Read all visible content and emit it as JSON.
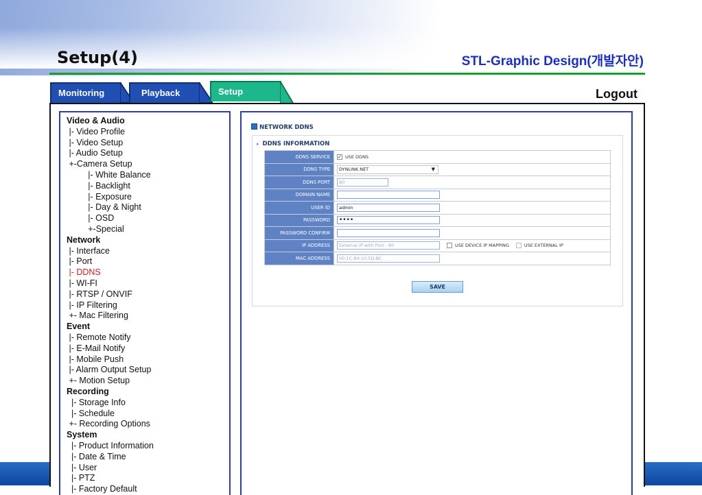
{
  "slide": {
    "title": "Setup(4)",
    "subtitle": "STL-Graphic Design(개발자안)"
  },
  "tabs": {
    "monitoring": "Monitoring",
    "playback": "Playback",
    "setup": "Setup",
    "logout": "Logout"
  },
  "colors": {
    "accent_green": "#16a02e",
    "tab_blue": "#1f4fb3",
    "tab_setup_teal": "#1cb88c",
    "active_menu_red": "#d81a1a",
    "subtitle_blue": "#1a2ecc"
  },
  "menu": [
    {
      "label": "Video & Audio",
      "kind": "cat"
    },
    {
      "label": " |- Video Profile",
      "kind": "item"
    },
    {
      "label": " |- Video Setup",
      "kind": "item"
    },
    {
      "label": " |- Audio Setup",
      "kind": "item"
    },
    {
      "label": " +-Camera Setup",
      "kind": "item"
    },
    {
      "label": "         |- White Balance",
      "kind": "item"
    },
    {
      "label": "         |- Backlight",
      "kind": "item"
    },
    {
      "label": "         |- Exposure",
      "kind": "item"
    },
    {
      "label": "         |- Day & Night",
      "kind": "item"
    },
    {
      "label": "         |- OSD",
      "kind": "item"
    },
    {
      "label": "         +-Special",
      "kind": "item"
    },
    {
      "label": "Network",
      "kind": "cat"
    },
    {
      "label": " |- Interface",
      "kind": "item"
    },
    {
      "label": " |- Port",
      "kind": "item"
    },
    {
      "label": " |- DDNS",
      "kind": "active"
    },
    {
      "label": " |- WI-FI",
      "kind": "item"
    },
    {
      "label": " |- RTSP / ONVIF",
      "kind": "item"
    },
    {
      "label": " |- IP Filtering",
      "kind": "item"
    },
    {
      "label": " +- Mac Filtering",
      "kind": "item"
    },
    {
      "label": "Event",
      "kind": "cat"
    },
    {
      "label": " |- Remote Notify",
      "kind": "item"
    },
    {
      "label": " |- E-Mail Notify",
      "kind": "item"
    },
    {
      "label": " |- Mobile Push",
      "kind": "item"
    },
    {
      "label": " |- Alarm Output Setup",
      "kind": "item"
    },
    {
      "label": " +- Motion Setup",
      "kind": "item"
    },
    {
      "label": "Recording",
      "kind": "cat"
    },
    {
      "label": "  |- Storage Info",
      "kind": "item"
    },
    {
      "label": "  |- Schedule",
      "kind": "item"
    },
    {
      "label": " +- Recording Options",
      "kind": "item"
    },
    {
      "label": "System",
      "kind": "cat"
    },
    {
      "label": "  |- Product Information",
      "kind": "item"
    },
    {
      "label": "  |- Date & Time",
      "kind": "item"
    },
    {
      "label": "  |- User",
      "kind": "item"
    },
    {
      "label": "  |- PTZ",
      "kind": "item"
    },
    {
      "label": "  |- Factory Default",
      "kind": "item"
    }
  ],
  "content": {
    "section_title": "NETWORK DDNS",
    "info_title": "DDNS INFORMATION",
    "rows": {
      "ddns_service": {
        "label": "DDNS SERVICE",
        "checkbox_label": "USE DDNS",
        "checked": true
      },
      "ddns_type": {
        "label": "DDNS TYPE",
        "value": "DYNLINK.NET"
      },
      "ddns_port": {
        "label": "DDNS PORT",
        "value": "80"
      },
      "domain_name": {
        "label": "DOMAIN NAME",
        "value": ""
      },
      "user_id": {
        "label": "USER ID",
        "value": "admin"
      },
      "password": {
        "label": "PASSWORD",
        "value": "••••"
      },
      "password_confirm": {
        "label": "PASSWORD CONFIRM",
        "value": ""
      },
      "ip_address": {
        "label": "IP ADDRESS",
        "placeholder": "External IP with Port : 80",
        "opt1": "USE DEVICE IP MAPPING",
        "opt2": "USE EXTERNAL IP"
      },
      "mac_address": {
        "label": "MAC ADDRESS",
        "value": "00:1C:84:10:5D:BC"
      }
    },
    "save_label": "SAVE"
  }
}
